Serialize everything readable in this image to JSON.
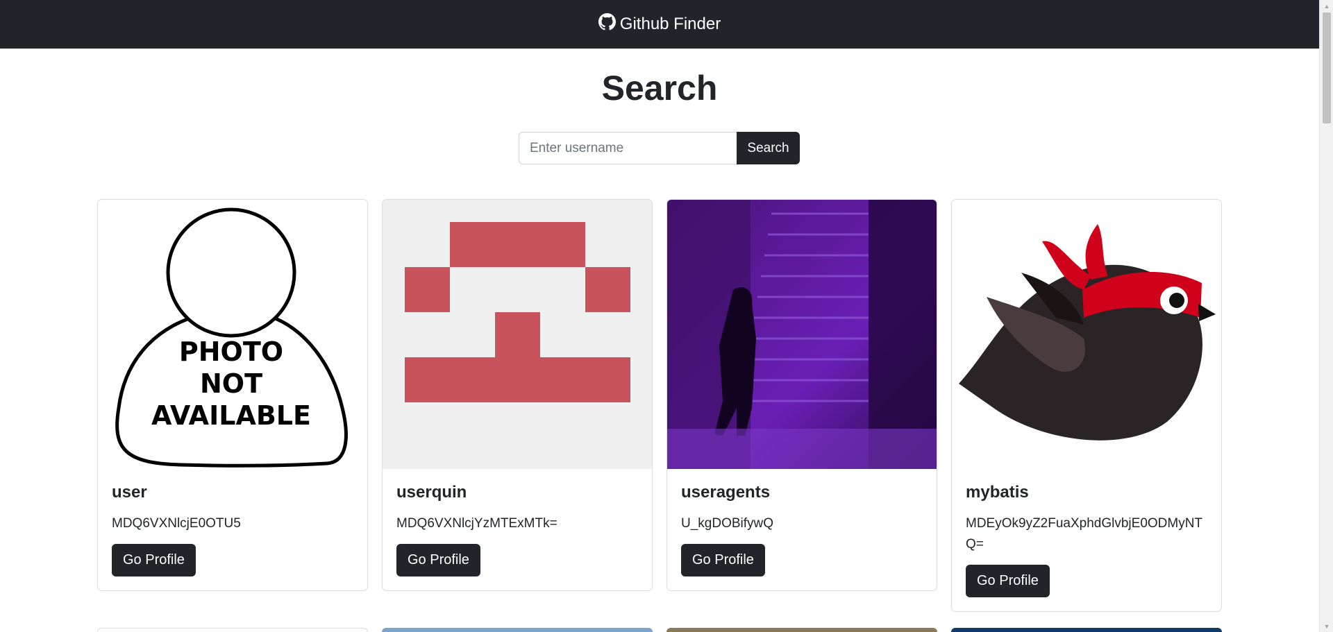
{
  "navbar": {
    "brand": "Github Finder",
    "brand_icon": "github-icon"
  },
  "search": {
    "title": "Search",
    "placeholder": "Enter username",
    "value": "",
    "button_label": "Search"
  },
  "cards": [
    {
      "login": "user",
      "node_id": "MDQ6VXNlcjE0OTU5",
      "button_label": "Go Profile",
      "avatar": "photo-not-available",
      "avatar_text": [
        "PHOTO",
        "NOT",
        "AVAILABLE"
      ]
    },
    {
      "login": "userquin",
      "node_id": "MDQ6VXNlcjYzMTExMTk=",
      "button_label": "Go Profile",
      "avatar": "identicon",
      "avatar_color": "#c9535d"
    },
    {
      "login": "useragents",
      "node_id": "U_kgDOBifywQ",
      "button_label": "Go Profile",
      "avatar": "purple-stairs-photo",
      "avatar_color": "#6a1fb5"
    },
    {
      "login": "mybatis",
      "node_id": "MDEyOk9yZ2FuaXphdGlvbjE0ODMyNTQ=",
      "button_label": "Go Profile",
      "avatar": "ninja-bird-logo",
      "avatar_color": "#d0021b"
    }
  ],
  "colors": {
    "navbar": "#212529",
    "button": "#212529",
    "background": "#ffffff"
  }
}
